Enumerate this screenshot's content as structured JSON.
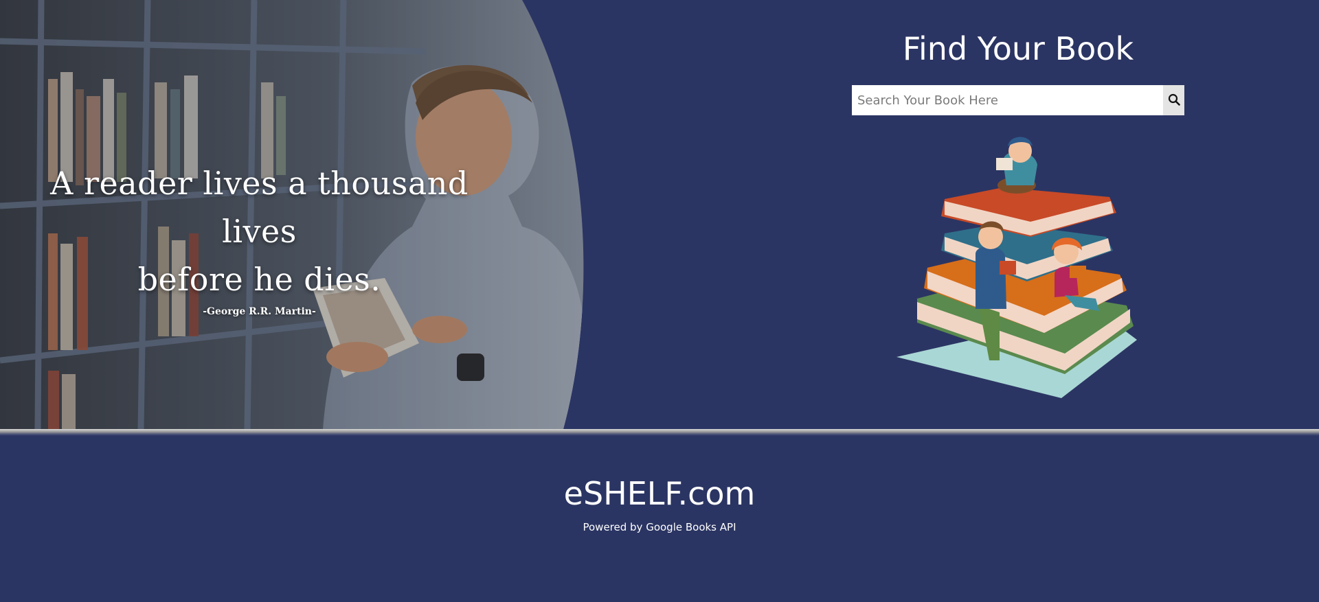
{
  "hero": {
    "quote": {
      "line1": "A reader lives a thousand lives",
      "line2": "before he dies.",
      "author": "-George R.R. Martin-"
    }
  },
  "finder": {
    "title": "Find Your Book",
    "search": {
      "placeholder": "Search Your Book Here",
      "value": "",
      "button_icon": "search-icon"
    }
  },
  "footer": {
    "brand": "eSHELF.com",
    "powered_by": "Powered by Google Books API"
  },
  "colors": {
    "background": "#2b3563",
    "text": "#ffffff",
    "search_button": "#e4e4e4"
  }
}
